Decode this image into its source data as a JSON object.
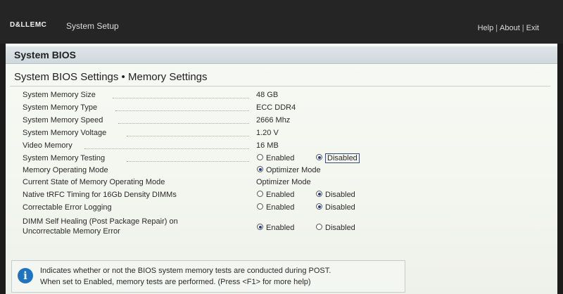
{
  "topbar": {
    "logo": "D&LLEMC",
    "app_title": "System Setup",
    "links": [
      "Help",
      "About",
      "Exit"
    ],
    "separator": "|"
  },
  "section": {
    "title": "System BIOS"
  },
  "page": {
    "heading": "System BIOS Settings • Memory Settings"
  },
  "settings": [
    {
      "label": "System Memory Size",
      "value": "48 GB"
    },
    {
      "label": "System Memory Type",
      "value": "ECC DDR4"
    },
    {
      "label": "System Memory Speed",
      "value": "2666 Mhz"
    },
    {
      "label": "System Memory Voltage",
      "value": "1.20 V"
    },
    {
      "label": "Video Memory",
      "value": "16 MB"
    },
    {
      "label": "System Memory Testing",
      "options": [
        "Enabled",
        "Disabled"
      ],
      "selected": "Disabled"
    },
    {
      "label": "Memory Operating Mode",
      "options": [
        "Optimizer Mode"
      ],
      "selected": "Optimizer Mode"
    },
    {
      "label": "Current State of Memory Operating Mode",
      "value": "Optimizer Mode"
    },
    {
      "label": "Native tRFC Timing for 16Gb Density DIMMs",
      "options": [
        "Enabled",
        "Disabled"
      ],
      "selected": "Disabled"
    },
    {
      "label": "Correctable Error Logging",
      "options": [
        "Enabled",
        "Disabled"
      ],
      "selected": "Disabled"
    },
    {
      "label_line1": "DIMM Self Healing (Post Package Repair) on",
      "label_line2": "Uncorrectable Memory Error",
      "options": [
        "Enabled",
        "Disabled"
      ],
      "selected": "Enabled"
    }
  ],
  "help": {
    "line1": "Indicates whether or not the BIOS system memory tests are conducted during POST.",
    "line2": "When set to Enabled, memory tests are performed. (Press <F1> for more help)"
  }
}
